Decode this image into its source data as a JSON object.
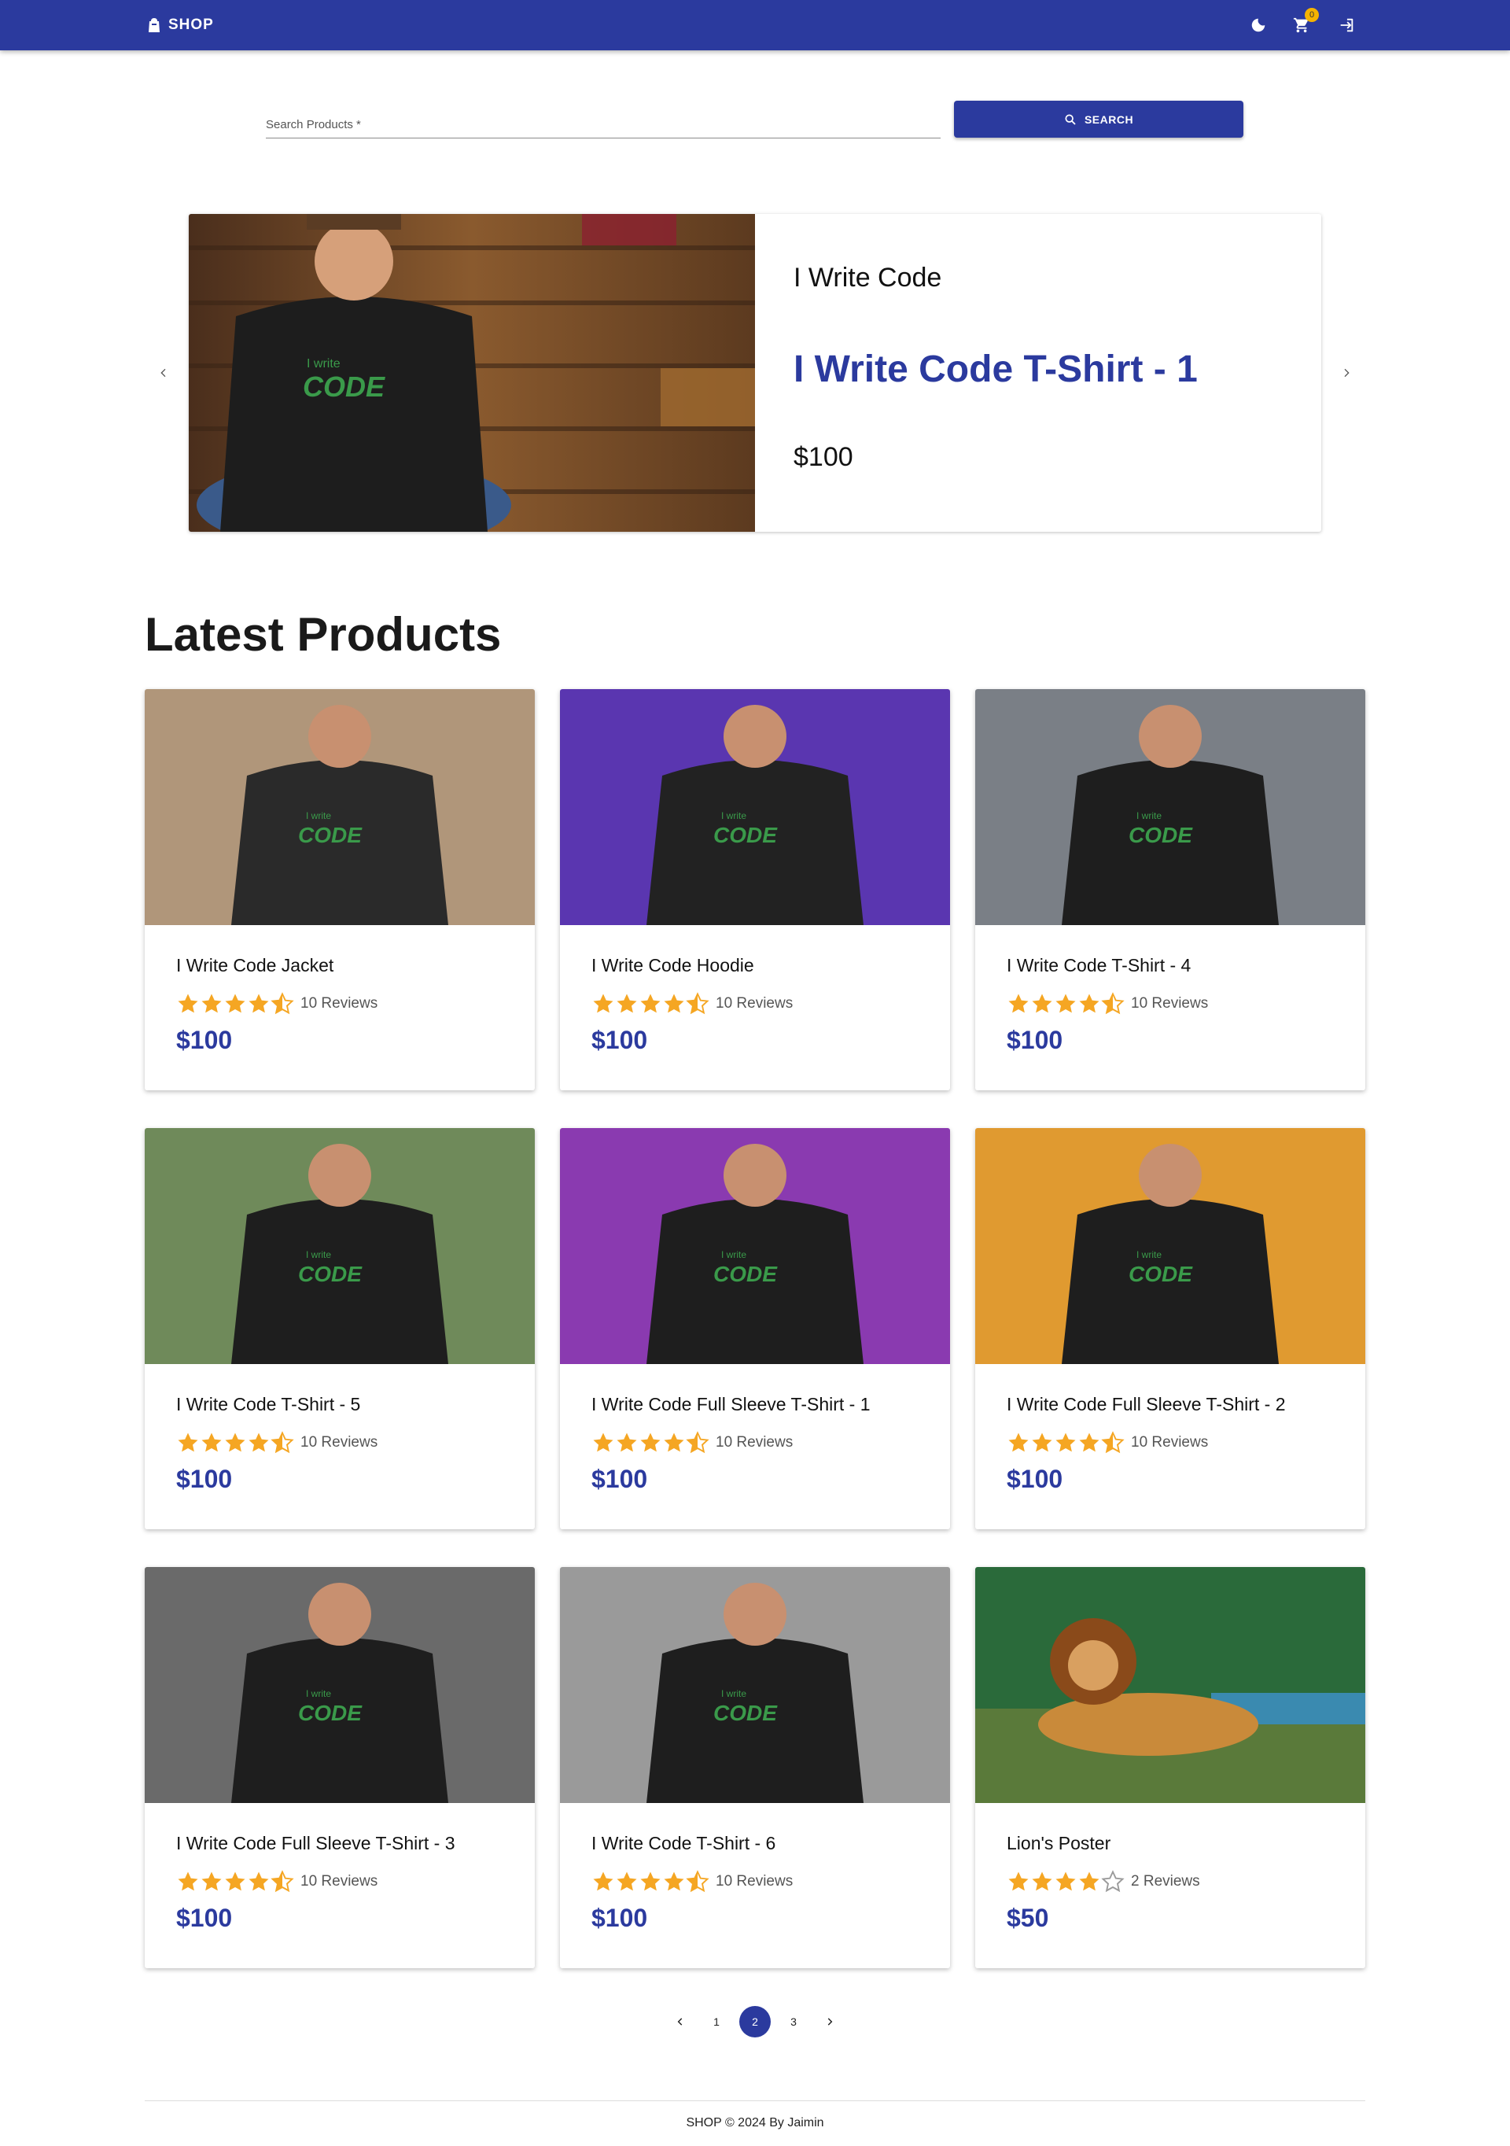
{
  "header": {
    "brand": "SHOP",
    "cart_count": "0"
  },
  "search": {
    "placeholder": "Search Products *",
    "button_label": "SEARCH"
  },
  "hero": {
    "subtitle": "I Write Code",
    "title": "I Write Code T-Shirt - 1",
    "price": "$100"
  },
  "section_title": "Latest Products",
  "products": [
    {
      "name": "I Write Code Jacket",
      "rating": 4.5,
      "reviews": "10 Reviews",
      "price": "$100"
    },
    {
      "name": "I Write Code Hoodie",
      "rating": 4.5,
      "reviews": "10 Reviews",
      "price": "$100"
    },
    {
      "name": "I Write Code T-Shirt - 4",
      "rating": 4.5,
      "reviews": "10 Reviews",
      "price": "$100"
    },
    {
      "name": "I Write Code T-Shirt - 5",
      "rating": 4.5,
      "reviews": "10 Reviews",
      "price": "$100"
    },
    {
      "name": "I Write Code Full Sleeve T-Shirt - 1",
      "rating": 4.5,
      "reviews": "10 Reviews",
      "price": "$100"
    },
    {
      "name": "I Write Code Full Sleeve T-Shirt - 2",
      "rating": 4.5,
      "reviews": "10 Reviews",
      "price": "$100"
    },
    {
      "name": "I Write Code Full Sleeve T-Shirt - 3",
      "rating": 4.5,
      "reviews": "10 Reviews",
      "price": "$100"
    },
    {
      "name": "I Write Code T-Shirt - 6",
      "rating": 4.5,
      "reviews": "10 Reviews",
      "price": "$100"
    },
    {
      "name": "Lion's Poster",
      "rating": 4,
      "reviews": "2 Reviews",
      "price": "$50"
    }
  ],
  "pagination": {
    "pages": [
      "1",
      "2",
      "3"
    ],
    "current": "2"
  },
  "footer": {
    "text": "SHOP © 2024 By Jaimin"
  },
  "colors": {
    "primary": "#2b3a9e",
    "star": "#f5a623",
    "badge": "#f5b300"
  }
}
